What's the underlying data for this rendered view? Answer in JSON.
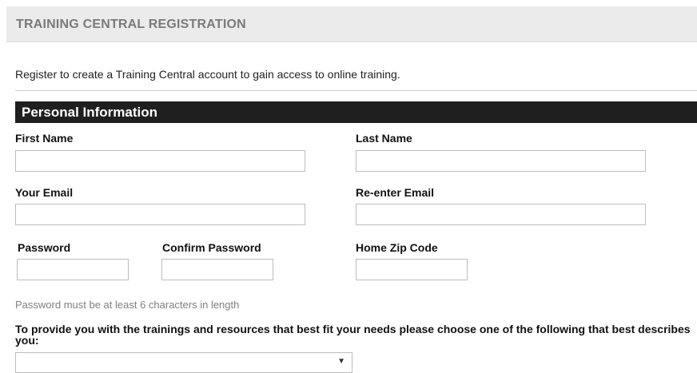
{
  "header": {
    "title": "TRAINING CENTRAL REGISTRATION"
  },
  "intro": "Register to create a Training Central account to gain access to online training.",
  "section": {
    "title": "Personal Information"
  },
  "form": {
    "first_name": {
      "label": "First Name",
      "value": ""
    },
    "last_name": {
      "label": "Last Name",
      "value": ""
    },
    "email": {
      "label": "Your Email",
      "value": ""
    },
    "reenter_email": {
      "label": "Re-enter Email",
      "value": ""
    },
    "password": {
      "label": "Password",
      "value": ""
    },
    "confirm_password": {
      "label": "Confirm Password",
      "value": ""
    },
    "zip": {
      "label": "Home Zip Code",
      "value": ""
    },
    "password_hint": "Password must be at least 6 characters in length",
    "role_question": "To provide you with the trainings and resources that best fit your needs please choose one of the following that best describes you:",
    "role_select": {
      "selected": ""
    }
  },
  "icons": {
    "dropdown": "chevron-down-icon"
  }
}
